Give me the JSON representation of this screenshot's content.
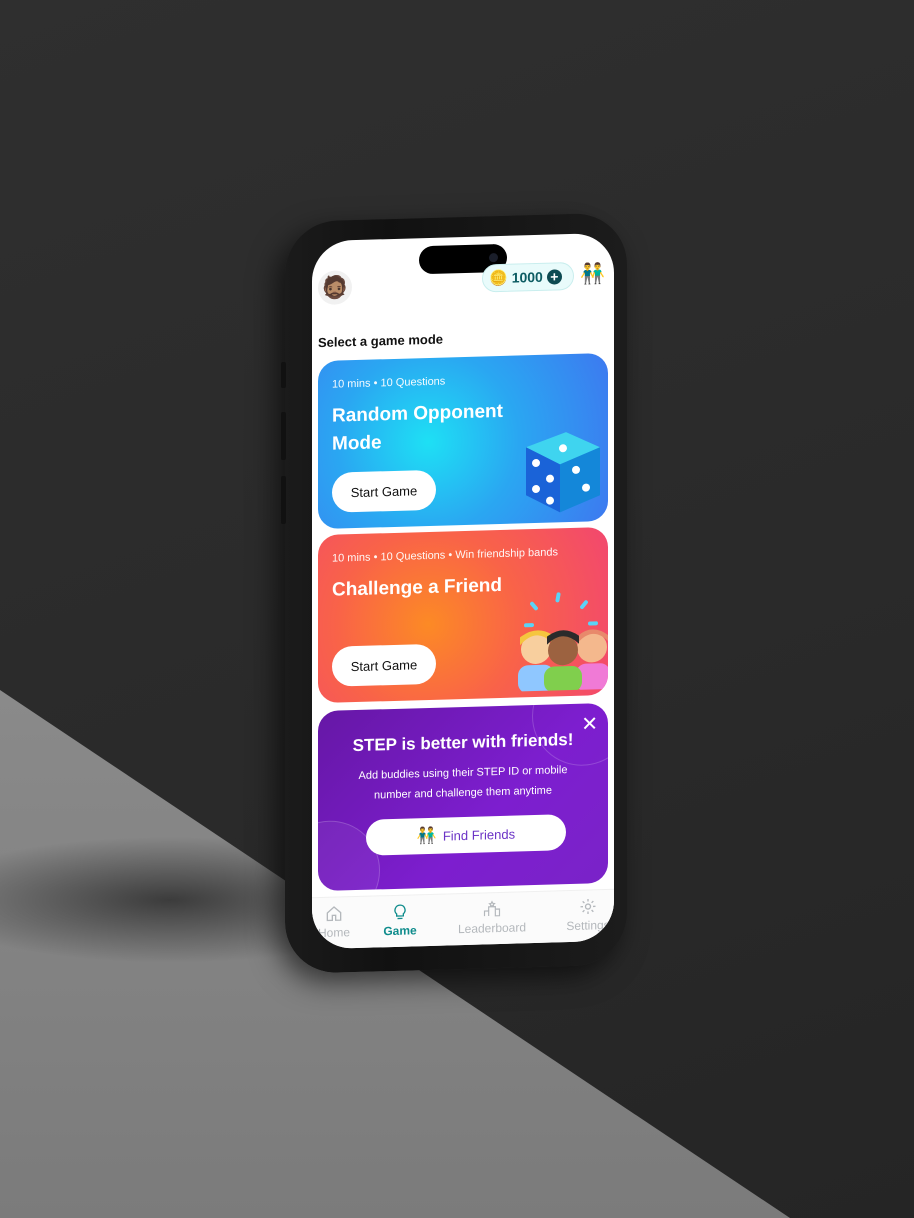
{
  "status": {
    "coins": "1000"
  },
  "colors": {
    "accent": "#0f8c8c",
    "promo_button_text": "#6b33c6"
  },
  "header": {
    "avatar_icon": "person-avatar-icon",
    "add_coins_icon": "plus-icon",
    "friends_icon": "friends-icon"
  },
  "main": {
    "section_title": "Select a game mode",
    "cards": [
      {
        "meta": "10 mins • 10 Questions",
        "title": "Random Opponent Mode",
        "button": "Start Game",
        "illustration": "dice-icon"
      },
      {
        "meta": "10 mins • 10 Questions • Win friendship bands",
        "title": "Challenge a Friend",
        "button": "Start Game",
        "illustration": "friends-group-icon"
      }
    ],
    "promo": {
      "title": "STEP is better with friends!",
      "subtitle": "Add buddies using their STEP ID or mobile number and challenge them anytime",
      "button": "Find Friends",
      "close_icon": "close-icon"
    }
  },
  "nav": {
    "items": [
      {
        "label": "Home",
        "icon": "home-icon",
        "active": false
      },
      {
        "label": "Game",
        "icon": "bulb-icon",
        "active": true
      },
      {
        "label": "Leaderboard",
        "icon": "podium-icon",
        "active": false
      },
      {
        "label": "Settings",
        "icon": "gear-icon",
        "active": false
      }
    ]
  }
}
